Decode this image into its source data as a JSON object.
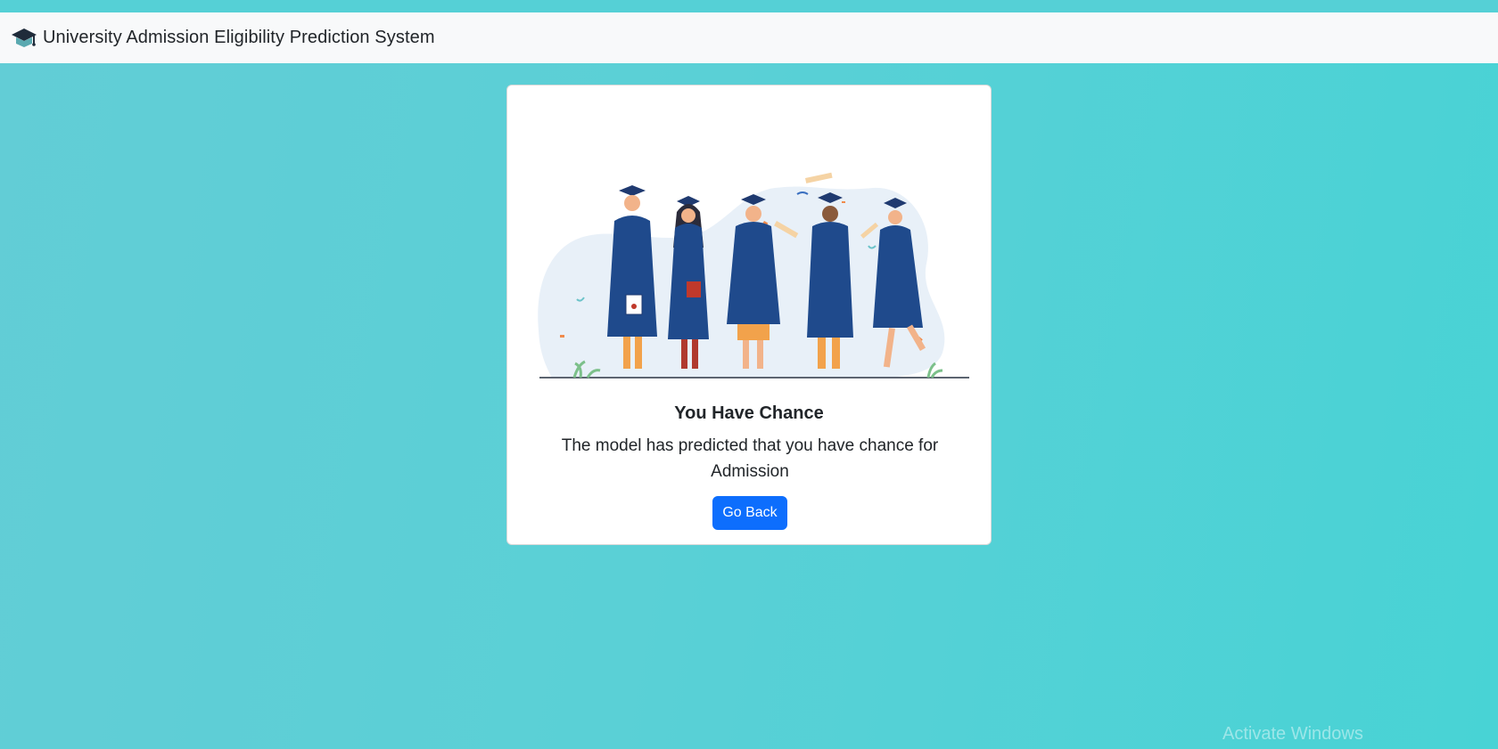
{
  "navbar": {
    "brand_icon": "graduation-cap-icon",
    "title": "University Admission Eligibility Prediction System"
  },
  "result_card": {
    "illustration": "graduates-celebrating-illustration",
    "title": "You Have Chance",
    "message": "The model has predicted that you have chance for Admission",
    "button_label": "Go Back"
  },
  "os_watermark": "Activate Windows",
  "colors": {
    "background_teal": "#55d0d6",
    "navbar_bg": "#f8f9fa",
    "button_primary": "#0d6efd",
    "gown_navy": "#1f4a8c"
  }
}
